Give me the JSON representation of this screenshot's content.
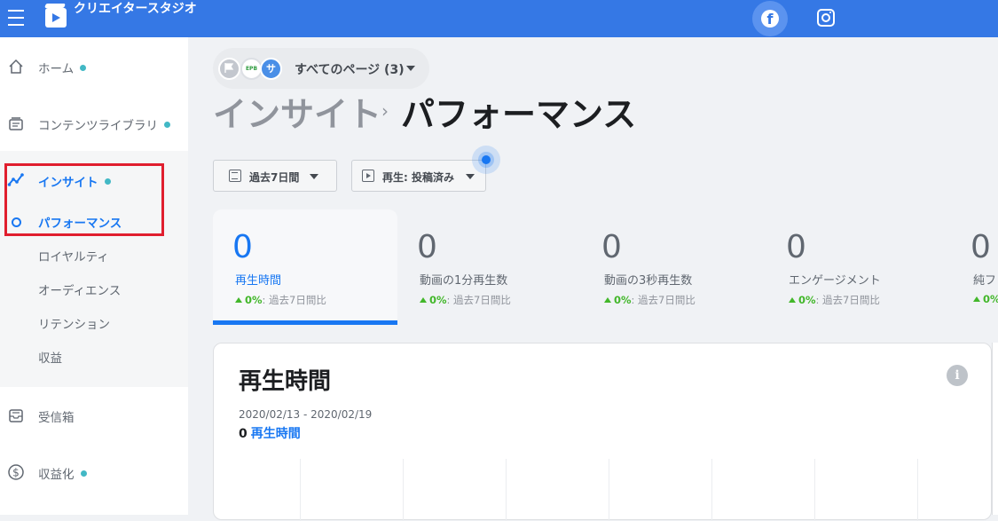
{
  "topbar": {
    "app_title": "クリエイタースタジオ",
    "icons": [
      "menu-icon",
      "creator-studio-logo",
      "facebook-icon",
      "instagram-icon"
    ],
    "facebook_glyph": "f",
    "accent": "#3578e5"
  },
  "sidebar": {
    "items": [
      {
        "label": "ホーム",
        "icon": "home-icon",
        "dot": true
      },
      {
        "label": "コンテンツライブラリ",
        "icon": "content-library-icon",
        "dot": true
      },
      {
        "label": "インサイト",
        "icon": "insights-icon",
        "dot": true,
        "active": true
      },
      {
        "label": "受信箱",
        "icon": "inbox-icon",
        "dot": false
      },
      {
        "label": "収益化",
        "icon": "monetization-icon",
        "dot": true
      }
    ],
    "insights_sub": [
      {
        "label": "パフォーマンス",
        "active": true
      },
      {
        "label": "ロイヤルティ"
      },
      {
        "label": "オーディエンス"
      },
      {
        "label": "リテンション"
      },
      {
        "label": "収益"
      }
    ],
    "dot_color": "#42b8c5",
    "highlight_color": "#e01e2e"
  },
  "page_selector": {
    "label": "すべてのページ (3)",
    "avatars": [
      "",
      "EPB",
      "サ"
    ]
  },
  "breadcrumb": {
    "parent": "インサイト",
    "separator": "›",
    "current": "パフォーマンス"
  },
  "filters": {
    "date_range": "過去7日間",
    "playback": "再生: 投稿済み"
  },
  "metrics": [
    {
      "value": "0",
      "label": "再生時間",
      "change": "0%",
      "compare": ": 過去7日間比",
      "selected": true
    },
    {
      "value": "0",
      "label": "動画の1分再生数",
      "change": "0%",
      "compare": ": 過去7日間比"
    },
    {
      "value": "0",
      "label": "動画の3秒再生数",
      "change": "0%",
      "compare": ": 過去7日間比"
    },
    {
      "value": "0",
      "label": "エンゲージメント",
      "change": "0%",
      "compare": ": 過去7日間比"
    },
    {
      "value": "0",
      "label": "純フ",
      "change": "0%",
      "compare": ""
    }
  ],
  "chart_card": {
    "title": "再生時間",
    "info_glyph": "i",
    "date_range": "2020/02/13 - 2020/02/19",
    "total_value": "0",
    "total_label": "再生時間"
  },
  "colors": {
    "primary": "#1877f2",
    "positive": "#42b72a"
  }
}
